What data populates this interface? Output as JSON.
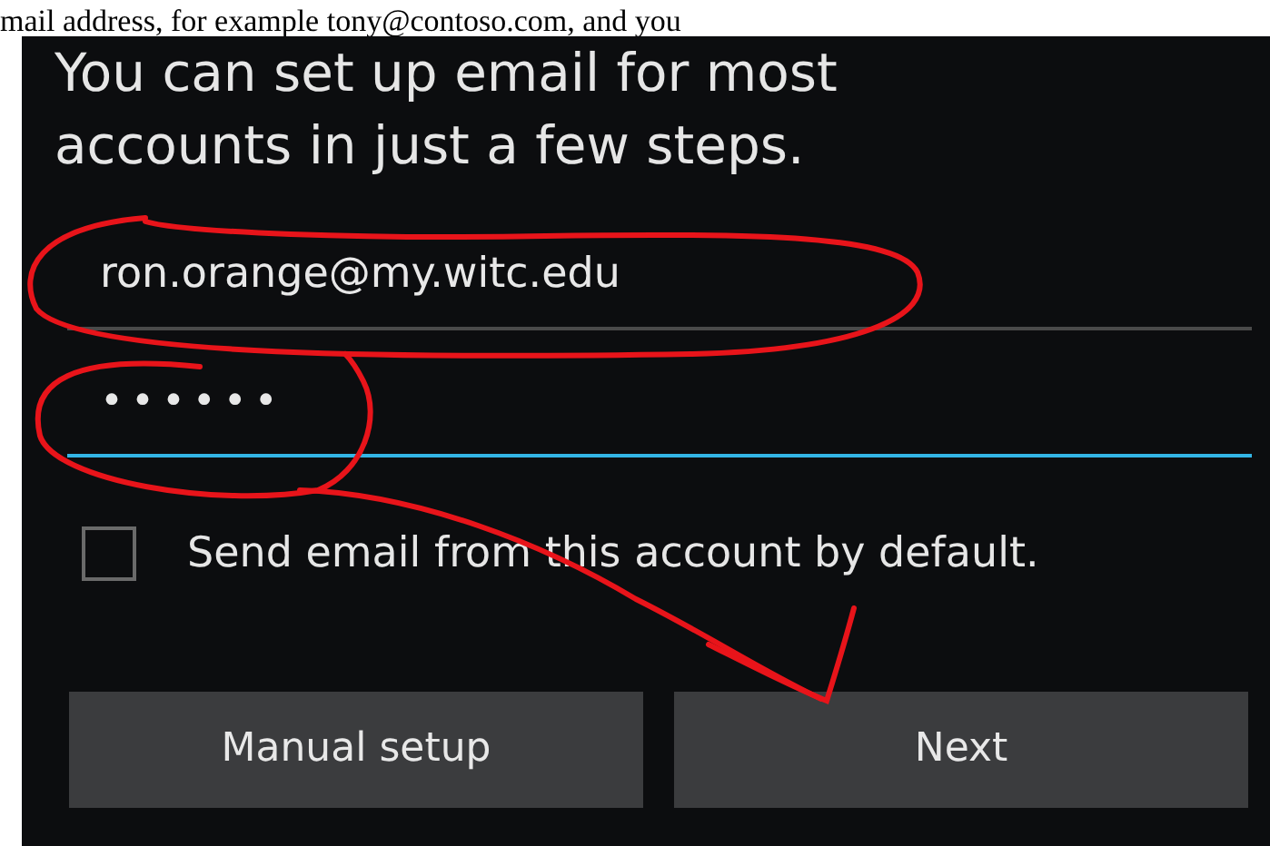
{
  "document_text": "mail address, for example tony@contoso.com, and you",
  "heading": "You can set up email for most accounts in just a few steps.",
  "fields": [
    {
      "kind": "email",
      "value": "ron.orange@my.witc.edu",
      "focused": false
    },
    {
      "kind": "password",
      "value": "••••••",
      "focused": true
    }
  ],
  "checkbox": {
    "label": "Send email from this account by default.",
    "checked": false
  },
  "buttons": [
    "Manual setup",
    "Next"
  ]
}
